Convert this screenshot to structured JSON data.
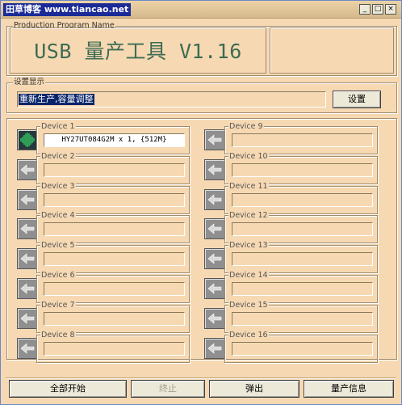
{
  "window": {
    "title": "田草博客 www.tiancao.net",
    "controls": {
      "minimize": "_",
      "maximize": "□",
      "close": "×"
    }
  },
  "production": {
    "legend": "Production Program Name",
    "program_name": "USB 量产工具 V1.16"
  },
  "settings": {
    "legend": "设置显示",
    "value": "重新生产,容量调整",
    "button_label": "设置"
  },
  "devices": [
    {
      "label": "Device 1",
      "value": "HY27UT084G2M x 1, {512M}",
      "active": true
    },
    {
      "label": "Device 2",
      "value": "",
      "active": false
    },
    {
      "label": "Device 3",
      "value": "",
      "active": false
    },
    {
      "label": "Device 4",
      "value": "",
      "active": false
    },
    {
      "label": "Device 5",
      "value": "",
      "active": false
    },
    {
      "label": "Device 6",
      "value": "",
      "active": false
    },
    {
      "label": "Device 7",
      "value": "",
      "active": false
    },
    {
      "label": "Device 8",
      "value": "",
      "active": false
    },
    {
      "label": "Device 9",
      "value": "",
      "active": false
    },
    {
      "label": "Device 10",
      "value": "",
      "active": false
    },
    {
      "label": "Device 11",
      "value": "",
      "active": false
    },
    {
      "label": "Device 12",
      "value": "",
      "active": false
    },
    {
      "label": "Device 13",
      "value": "",
      "active": false
    },
    {
      "label": "Device 14",
      "value": "",
      "active": false
    },
    {
      "label": "Device 15",
      "value": "",
      "active": false
    },
    {
      "label": "Device 16",
      "value": "",
      "active": false
    }
  ],
  "icons": {
    "active": "usb-activity-icon",
    "idle": "arrow-left-icon"
  },
  "footer": {
    "start_all": "全部开始",
    "stop": "终止",
    "eject": "弹出",
    "info": "量产信息"
  },
  "colors": {
    "background": "#f6d9b3",
    "title_highlight": "#1a2b98",
    "program_name": "#3d6b53",
    "selection": "#0a246a"
  }
}
